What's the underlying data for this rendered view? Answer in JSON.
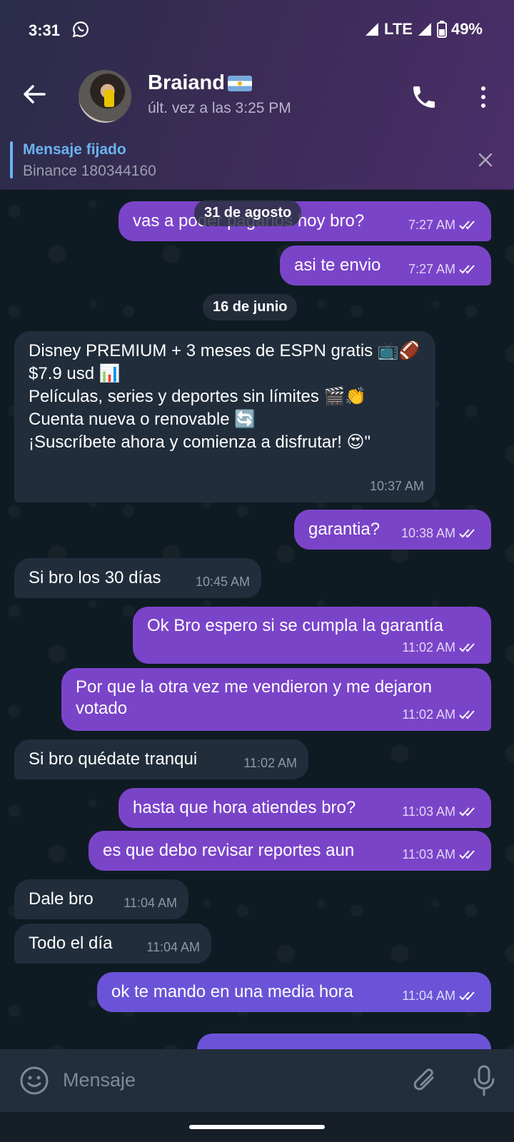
{
  "status_bar": {
    "time": "3:31",
    "network": "LTE",
    "battery": "49%"
  },
  "header": {
    "contact_name": "Braiand",
    "last_seen": "últ. vez a las 3:25 PM"
  },
  "pinned": {
    "title": "Mensaje fijado",
    "text": "Binance  180344160"
  },
  "dates": [
    "31 de agosto",
    "16 de junio"
  ],
  "messages": [
    {
      "dir": "out",
      "text": "vas a poder pagarlos hoy bro?",
      "time": "7:27 AM"
    },
    {
      "dir": "out",
      "text": "asi te envio",
      "time": "7:27 AM"
    },
    {
      "dir": "in",
      "text": "Disney PREMIUM + 3 meses de ESPN gratis 📺🏈\n$7.9 usd 📊\nPelículas, series y deportes sin límites 🎬👏\nCuenta nueva o renovable 🔄\n¡Suscríbete ahora y comienza a disfrutar! 😍\"",
      "time": "10:37 AM"
    },
    {
      "dir": "out",
      "text": "garantia?",
      "time": "10:38 AM"
    },
    {
      "dir": "in",
      "text": "Si bro los 30 días",
      "time": "10:45 AM"
    },
    {
      "dir": "out",
      "text": "Ok Bro espero si se cumpla la garantía",
      "time": "11:02 AM"
    },
    {
      "dir": "out",
      "text": "Por que la otra vez me vendieron y me dejaron\nvotado",
      "time": "11:02 AM"
    },
    {
      "dir": "in",
      "text": "Si bro quédate tranqui",
      "time": "11:02 AM"
    },
    {
      "dir": "out",
      "text": "hasta que hora atiendes bro?",
      "time": "11:03 AM"
    },
    {
      "dir": "out",
      "text": "es que debo revisar reportes aun",
      "time": "11:03 AM"
    },
    {
      "dir": "in",
      "text": "Dale bro",
      "time": "11:04 AM"
    },
    {
      "dir": "in",
      "text": "Todo el día",
      "time": "11:04 AM"
    },
    {
      "dir": "out",
      "text": "ok te mando en una media hora",
      "time": "11:04 AM"
    }
  ],
  "input": {
    "placeholder": "Mensaje"
  },
  "colors": {
    "outgoing": "#7a44c9",
    "incoming": "#212d3b",
    "accent": "#6ab3f3"
  }
}
